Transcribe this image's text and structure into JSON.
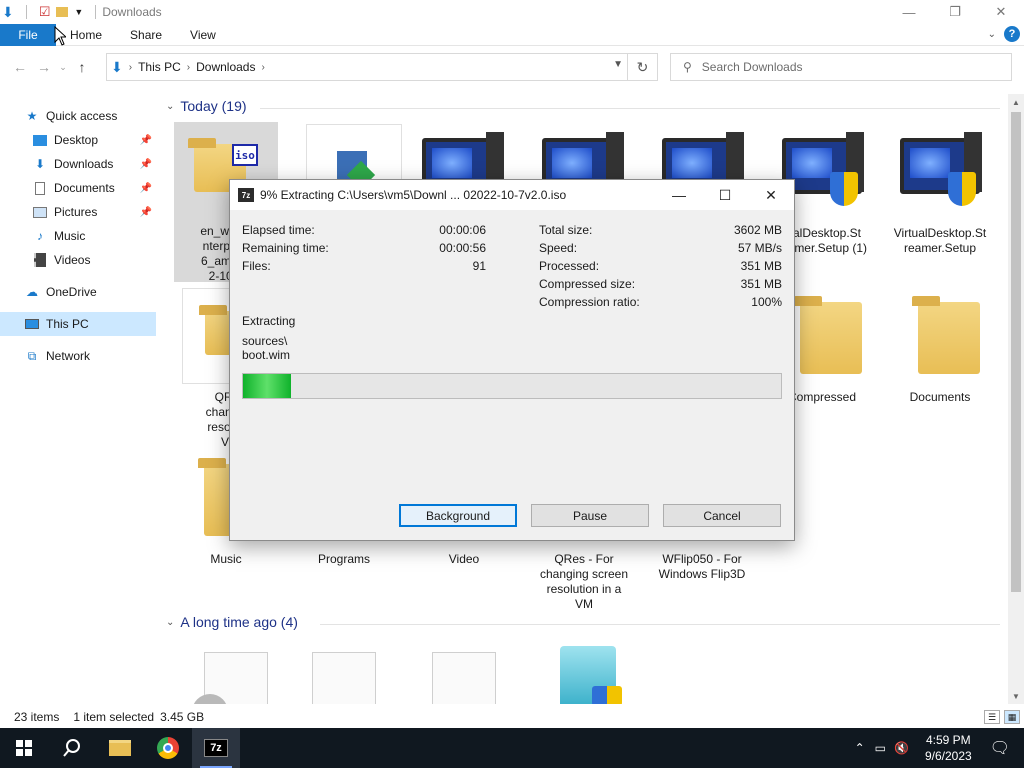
{
  "window": {
    "title": "Downloads",
    "ribbon_tabs": [
      "File",
      "Home",
      "Share",
      "View"
    ]
  },
  "address": {
    "crumbs": [
      "This PC",
      "Downloads"
    ],
    "search_placeholder": "Search Downloads"
  },
  "nav": {
    "items": [
      {
        "label": "Quick access",
        "icon": "star-icon"
      },
      {
        "label": "Desktop",
        "icon": "desktop-icon",
        "pinned": true
      },
      {
        "label": "Downloads",
        "icon": "download-arrow-icon",
        "pinned": true
      },
      {
        "label": "Documents",
        "icon": "document-icon",
        "pinned": true
      },
      {
        "label": "Pictures",
        "icon": "picture-icon",
        "pinned": true
      },
      {
        "label": "Music",
        "icon": "music-note-icon"
      },
      {
        "label": "Videos",
        "icon": "film-icon"
      },
      {
        "label": "OneDrive",
        "icon": "cloud-icon"
      },
      {
        "label": "This PC",
        "icon": "computer-icon",
        "selected": true
      },
      {
        "label": "Network",
        "icon": "network-icon"
      }
    ]
  },
  "groups": {
    "today": "Today (19)",
    "long_ago": "A long time ago (4)"
  },
  "files": {
    "iso": [
      "en_windo",
      "nterprise",
      "6_amd64",
      "2-10-7"
    ],
    "qres_partial": [
      "QRes",
      "changing",
      "resolutio",
      "VM"
    ],
    "vdesk1": [
      "tualDesktop.St",
      "reamer.Setup (1)"
    ],
    "vdesk2": [
      "VirtualDesktop.St",
      "reamer.Setup"
    ],
    "compressed": "Compressed",
    "documents": "Documents",
    "music": "Music",
    "programs": "Programs",
    "video": "Video",
    "qres": [
      "QRes - For",
      "changing screen",
      "resolution in a",
      "VM"
    ],
    "wflip": [
      "WFlip050 - For",
      "Windows Flip3D"
    ]
  },
  "status": {
    "items": "23 items",
    "selected": "1 item selected",
    "size": "3.45 GB"
  },
  "taskbar": {
    "time": "4:59 PM",
    "date": "9/6/2023",
    "apps": [
      "start-icon",
      "search-icon",
      "file-explorer-icon",
      "chrome-icon",
      "7zip-icon"
    ]
  },
  "dialog": {
    "title": "9% Extracting C:\\Users\\vm5\\Downl ... 02022-10-7v2.0.iso",
    "app_badge": "7z",
    "progress_percent": 9,
    "left": [
      {
        "label": "Elapsed time:",
        "value": "00:00:06"
      },
      {
        "label": "Remaining time:",
        "value": "00:00:56"
      },
      {
        "label": "Files:",
        "value": "91"
      }
    ],
    "right": [
      {
        "label": "Total size:",
        "value": "3602 MB"
      },
      {
        "label": "Speed:",
        "value": "57 MB/s"
      },
      {
        "label": "Processed:",
        "value": "351 MB"
      },
      {
        "label": "Compressed size:",
        "value": "351 MB"
      },
      {
        "label": "Compression ratio:",
        "value": "100%"
      }
    ],
    "action": "Extracting",
    "path1": "sources\\",
    "path2": "boot.wim",
    "buttons": {
      "background": "Background",
      "pause": "Pause",
      "cancel": "Cancel"
    }
  }
}
